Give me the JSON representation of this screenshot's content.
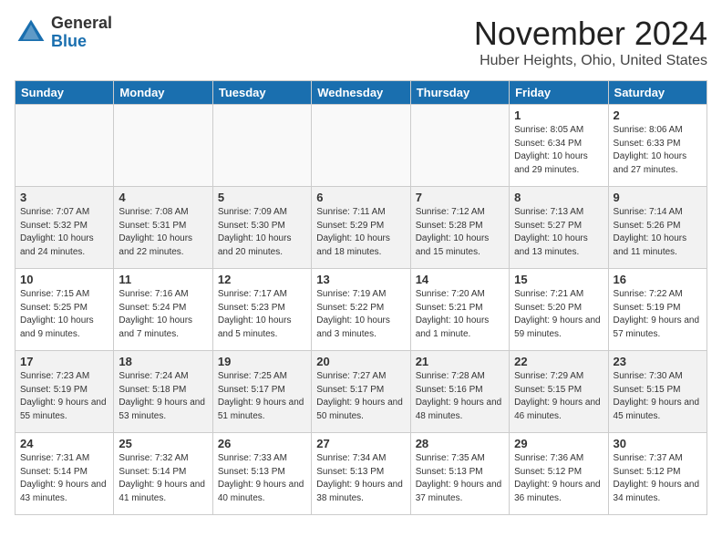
{
  "header": {
    "logo_general": "General",
    "logo_blue": "Blue",
    "month": "November 2024",
    "location": "Huber Heights, Ohio, United States"
  },
  "weekdays": [
    "Sunday",
    "Monday",
    "Tuesday",
    "Wednesday",
    "Thursday",
    "Friday",
    "Saturday"
  ],
  "weeks": [
    [
      {
        "day": "",
        "info": ""
      },
      {
        "day": "",
        "info": ""
      },
      {
        "day": "",
        "info": ""
      },
      {
        "day": "",
        "info": ""
      },
      {
        "day": "",
        "info": ""
      },
      {
        "day": "1",
        "info": "Sunrise: 8:05 AM\nSunset: 6:34 PM\nDaylight: 10 hours and 29 minutes."
      },
      {
        "day": "2",
        "info": "Sunrise: 8:06 AM\nSunset: 6:33 PM\nDaylight: 10 hours and 27 minutes."
      }
    ],
    [
      {
        "day": "3",
        "info": "Sunrise: 7:07 AM\nSunset: 5:32 PM\nDaylight: 10 hours and 24 minutes."
      },
      {
        "day": "4",
        "info": "Sunrise: 7:08 AM\nSunset: 5:31 PM\nDaylight: 10 hours and 22 minutes."
      },
      {
        "day": "5",
        "info": "Sunrise: 7:09 AM\nSunset: 5:30 PM\nDaylight: 10 hours and 20 minutes."
      },
      {
        "day": "6",
        "info": "Sunrise: 7:11 AM\nSunset: 5:29 PM\nDaylight: 10 hours and 18 minutes."
      },
      {
        "day": "7",
        "info": "Sunrise: 7:12 AM\nSunset: 5:28 PM\nDaylight: 10 hours and 15 minutes."
      },
      {
        "day": "8",
        "info": "Sunrise: 7:13 AM\nSunset: 5:27 PM\nDaylight: 10 hours and 13 minutes."
      },
      {
        "day": "9",
        "info": "Sunrise: 7:14 AM\nSunset: 5:26 PM\nDaylight: 10 hours and 11 minutes."
      }
    ],
    [
      {
        "day": "10",
        "info": "Sunrise: 7:15 AM\nSunset: 5:25 PM\nDaylight: 10 hours and 9 minutes."
      },
      {
        "day": "11",
        "info": "Sunrise: 7:16 AM\nSunset: 5:24 PM\nDaylight: 10 hours and 7 minutes."
      },
      {
        "day": "12",
        "info": "Sunrise: 7:17 AM\nSunset: 5:23 PM\nDaylight: 10 hours and 5 minutes."
      },
      {
        "day": "13",
        "info": "Sunrise: 7:19 AM\nSunset: 5:22 PM\nDaylight: 10 hours and 3 minutes."
      },
      {
        "day": "14",
        "info": "Sunrise: 7:20 AM\nSunset: 5:21 PM\nDaylight: 10 hours and 1 minute."
      },
      {
        "day": "15",
        "info": "Sunrise: 7:21 AM\nSunset: 5:20 PM\nDaylight: 9 hours and 59 minutes."
      },
      {
        "day": "16",
        "info": "Sunrise: 7:22 AM\nSunset: 5:19 PM\nDaylight: 9 hours and 57 minutes."
      }
    ],
    [
      {
        "day": "17",
        "info": "Sunrise: 7:23 AM\nSunset: 5:19 PM\nDaylight: 9 hours and 55 minutes."
      },
      {
        "day": "18",
        "info": "Sunrise: 7:24 AM\nSunset: 5:18 PM\nDaylight: 9 hours and 53 minutes."
      },
      {
        "day": "19",
        "info": "Sunrise: 7:25 AM\nSunset: 5:17 PM\nDaylight: 9 hours and 51 minutes."
      },
      {
        "day": "20",
        "info": "Sunrise: 7:27 AM\nSunset: 5:17 PM\nDaylight: 9 hours and 50 minutes."
      },
      {
        "day": "21",
        "info": "Sunrise: 7:28 AM\nSunset: 5:16 PM\nDaylight: 9 hours and 48 minutes."
      },
      {
        "day": "22",
        "info": "Sunrise: 7:29 AM\nSunset: 5:15 PM\nDaylight: 9 hours and 46 minutes."
      },
      {
        "day": "23",
        "info": "Sunrise: 7:30 AM\nSunset: 5:15 PM\nDaylight: 9 hours and 45 minutes."
      }
    ],
    [
      {
        "day": "24",
        "info": "Sunrise: 7:31 AM\nSunset: 5:14 PM\nDaylight: 9 hours and 43 minutes."
      },
      {
        "day": "25",
        "info": "Sunrise: 7:32 AM\nSunset: 5:14 PM\nDaylight: 9 hours and 41 minutes."
      },
      {
        "day": "26",
        "info": "Sunrise: 7:33 AM\nSunset: 5:13 PM\nDaylight: 9 hours and 40 minutes."
      },
      {
        "day": "27",
        "info": "Sunrise: 7:34 AM\nSunset: 5:13 PM\nDaylight: 9 hours and 38 minutes."
      },
      {
        "day": "28",
        "info": "Sunrise: 7:35 AM\nSunset: 5:13 PM\nDaylight: 9 hours and 37 minutes."
      },
      {
        "day": "29",
        "info": "Sunrise: 7:36 AM\nSunset: 5:12 PM\nDaylight: 9 hours and 36 minutes."
      },
      {
        "day": "30",
        "info": "Sunrise: 7:37 AM\nSunset: 5:12 PM\nDaylight: 9 hours and 34 minutes."
      }
    ]
  ]
}
